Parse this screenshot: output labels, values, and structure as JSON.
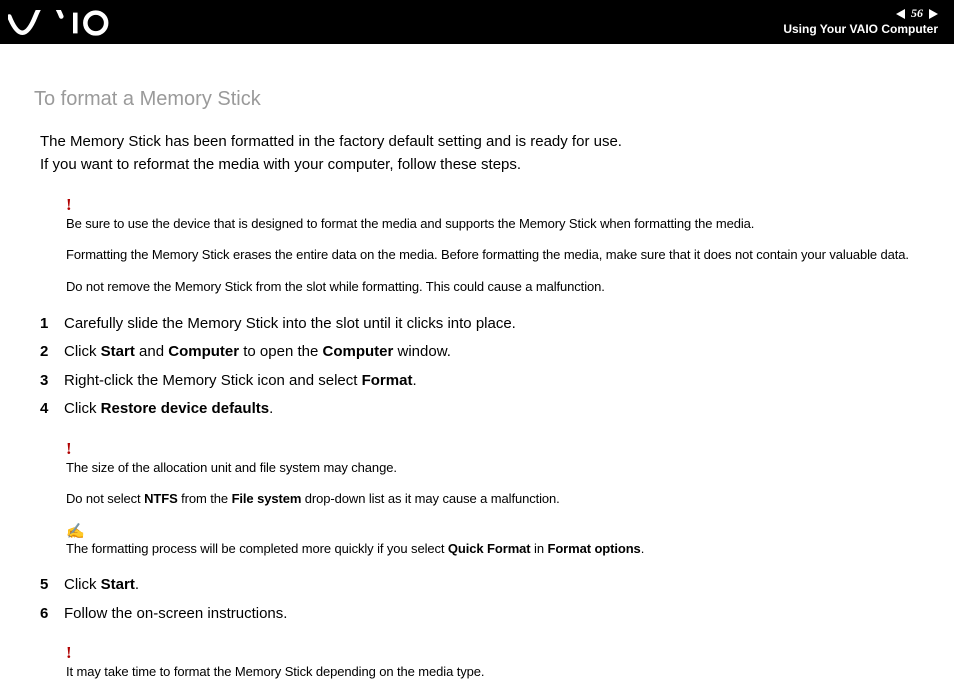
{
  "header": {
    "page_number": "56",
    "section": "Using Your VAIO Computer"
  },
  "heading": "To format a Memory Stick",
  "intro_line1": "The Memory Stick has been formatted in the factory default setting and is ready for use.",
  "intro_line2": "If you want to reformat the media with your computer, follow these steps.",
  "warn1_l1": "Be sure to use the device that is designed to format the media and supports the Memory Stick when formatting the media.",
  "warn1_l2": "Formatting the Memory Stick erases the entire data on the media. Before formatting the media, make sure that it does not contain your valuable data.",
  "warn1_l3": "Do not remove the Memory Stick from the slot while formatting. This could cause a malfunction.",
  "steps": [
    {
      "n": "1",
      "pre": "Carefully slide the Memory Stick into the slot until it clicks into place."
    },
    {
      "n": "2",
      "pre": "Click ",
      "b1": "Start",
      "mid": " and ",
      "b2": "Computer",
      "post": " to open the ",
      "b3": "Computer",
      "end": " window."
    },
    {
      "n": "3",
      "pre": "Right-click the Memory Stick icon and select ",
      "b1": "Format",
      "end": "."
    },
    {
      "n": "4",
      "pre": "Click ",
      "b1": "Restore device defaults",
      "end": "."
    }
  ],
  "warn2_l1": "The size of the allocation unit and file system may change.",
  "warn2_l2_pre": "Do not select ",
  "warn2_l2_b1": "NTFS",
  "warn2_l2_mid": " from the ",
  "warn2_l2_b2": "File system",
  "warn2_l2_post": " drop-down list as it may cause a malfunction.",
  "tip_pre": "The formatting process will be completed more quickly if you select ",
  "tip_b1": "Quick Format",
  "tip_mid": " in ",
  "tip_b2": "Format options",
  "tip_end": ".",
  "steps2": [
    {
      "n": "5",
      "pre": "Click ",
      "b1": "Start",
      "end": "."
    },
    {
      "n": "6",
      "pre": "Follow the on-screen instructions."
    }
  ],
  "warn3": "It may take time to format the Memory Stick depending on the media type."
}
